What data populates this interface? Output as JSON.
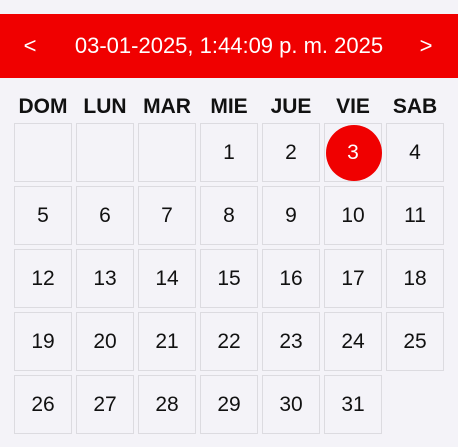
{
  "header": {
    "prev_label": "<",
    "next_label": ">",
    "title": "03-01-2025, 1:44:09 p. m. 2025"
  },
  "weekdays": [
    "DOM",
    "LUN",
    "MAR",
    "MIE",
    "JUE",
    "VIE",
    "SAB"
  ],
  "calendar": {
    "leading_blanks": 3,
    "days_in_month": 31,
    "selected_day": 3,
    "days": [
      "1",
      "2",
      "3",
      "4",
      "5",
      "6",
      "7",
      "8",
      "9",
      "10",
      "11",
      "12",
      "13",
      "14",
      "15",
      "16",
      "17",
      "18",
      "19",
      "20",
      "21",
      "22",
      "23",
      "24",
      "25",
      "26",
      "27",
      "28",
      "29",
      "30",
      "31"
    ]
  },
  "colors": {
    "accent": "#f00000",
    "background": "#f4f3f8",
    "cell_border": "#dcdbe0",
    "text": "#111111"
  },
  "icons": {
    "prev": "chevron-left-icon",
    "next": "chevron-right-icon"
  }
}
